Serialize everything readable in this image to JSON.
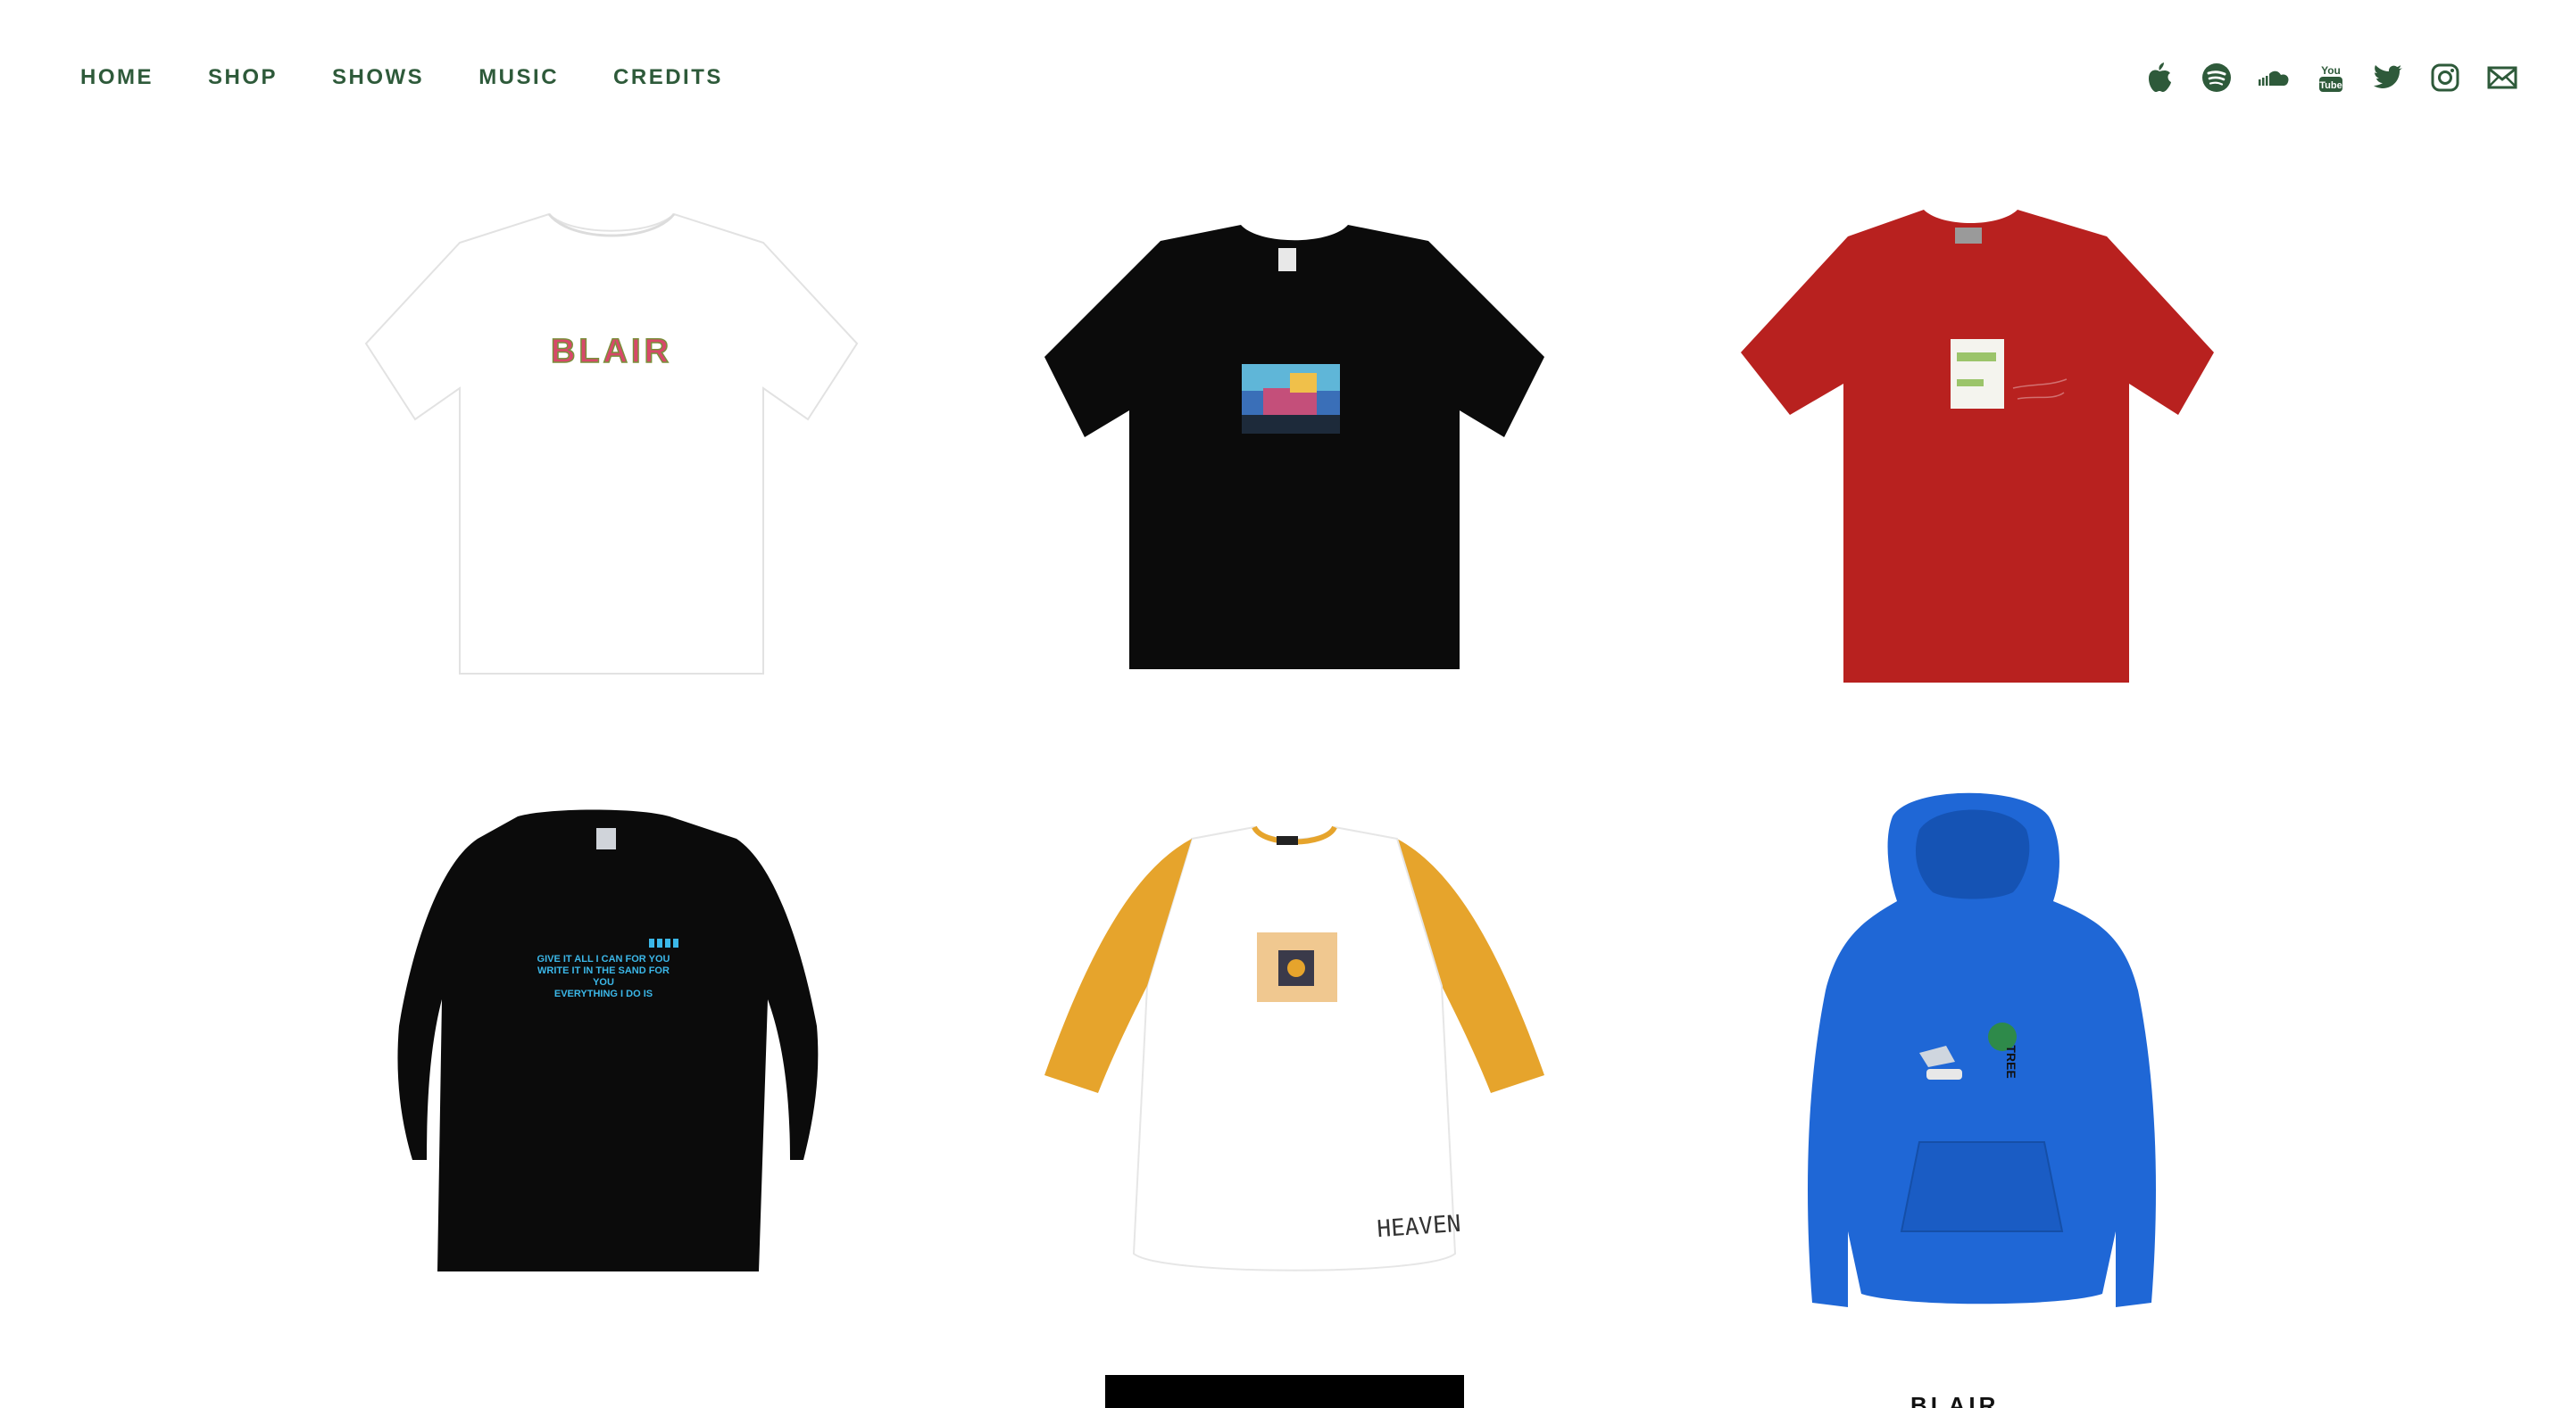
{
  "nav": {
    "items": [
      {
        "label": "HOME"
      },
      {
        "label": "SHOP"
      },
      {
        "label": "SHOWS"
      },
      {
        "label": "MUSIC"
      },
      {
        "label": "CREDITS"
      }
    ]
  },
  "social": {
    "icons": [
      "apple-music-icon",
      "spotify-icon",
      "soundcloud-icon",
      "youtube-icon",
      "twitter-icon",
      "instagram-icon",
      "mail-icon"
    ],
    "color": "#2e5a3a"
  },
  "products": [
    {
      "garment": "white tee",
      "color": "#ffffff",
      "print_text": "BLAIR"
    },
    {
      "garment": "black tee",
      "color": "#0b0b0b"
    },
    {
      "garment": "red tee",
      "color": "#b8211f"
    },
    {
      "garment": "black longsleeve",
      "color": "#0b0b0b",
      "print_lines": [
        "GIVE IT ALL I CAN FOR YOU",
        "WRITE IT IN THE SAND FOR",
        "YOU",
        "EVERYTHING I DO IS"
      ]
    },
    {
      "garment": "raglan tee",
      "color": "#ffffff",
      "sleeve_color": "#e6a42c",
      "print_text": "HEAVEN"
    },
    {
      "garment": "blue hoodie",
      "color": "#1f67d6",
      "print_text": "TREE"
    },
    {
      "garment": "black item (partially visible)",
      "color": "#000000"
    },
    {
      "garment": "item (partially visible)",
      "color": "#111111",
      "print_text": "BLAIR"
    }
  ]
}
